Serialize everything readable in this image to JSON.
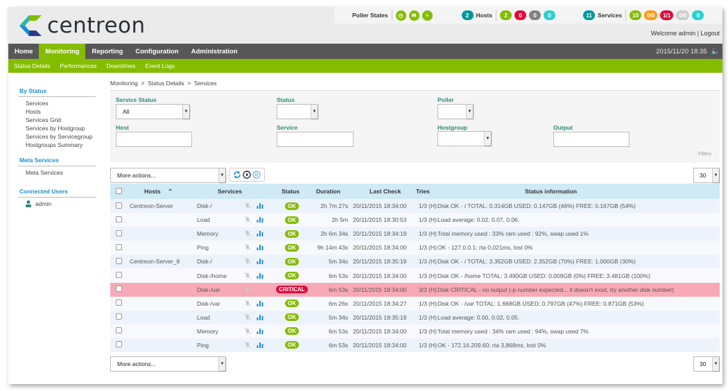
{
  "brand": {
    "name": "centreon"
  },
  "status_bar": {
    "poller_label": "Poller States",
    "hosts": {
      "total": "2",
      "label": "Hosts",
      "up": "2",
      "down": "0",
      "unreachable": "0",
      "pending": "0"
    },
    "services": {
      "total": "11",
      "label": "Services",
      "ok": "10",
      "warning": "0/0",
      "critical": "1/1",
      "unknown": "0/0",
      "pending": "0"
    },
    "colors": {
      "green": "#84bd00",
      "red": "#e00b3d",
      "grey": "#818285",
      "cyan": "#29d1d3",
      "teal": "#00989d",
      "orange": "#ff9a13",
      "lightgrey": "#cdcdcd"
    }
  },
  "welcome": {
    "text": "Welcome admin",
    "logout": "Logout"
  },
  "nav": {
    "tabs": [
      {
        "label": "Home",
        "active": false
      },
      {
        "label": "Monitoring",
        "active": true
      },
      {
        "label": "Reporting",
        "active": false
      },
      {
        "label": "Configuration",
        "active": false
      },
      {
        "label": "Administration",
        "active": false
      }
    ],
    "clock": "2015/11/20 18:35"
  },
  "subnav": [
    "Status Details",
    "Performances",
    "Downtimes",
    "Event Logs"
  ],
  "sidebar": {
    "groups": [
      {
        "title": "By Status",
        "items": [
          "Services",
          "Hosts",
          "Services Grid",
          "Services by Hostgroup",
          "Services by Servicegroup",
          "Hostgroups Summary"
        ]
      },
      {
        "title": "Meta Services",
        "items": [
          "Meta Services"
        ]
      },
      {
        "title": "Connected Users",
        "items": []
      }
    ],
    "user": "admin"
  },
  "breadcrumb": "Monitoring  >  Status Details  >  Services",
  "filters": {
    "service_status": {
      "label": "Service Status",
      "value": "All"
    },
    "status": {
      "label": "Status",
      "value": ""
    },
    "poller": {
      "label": "Poller",
      "value": ""
    },
    "host": {
      "label": "Host",
      "value": ""
    },
    "service": {
      "label": "Service",
      "value": ""
    },
    "hostgroup": {
      "label": "Hostgroup",
      "value": ""
    },
    "output": {
      "label": "Output",
      "value": ""
    },
    "tag": "Filters"
  },
  "actions": {
    "more_actions": "More actions...",
    "page_size": "30"
  },
  "table": {
    "headers": {
      "hosts": "Hosts",
      "services": "Services",
      "status": "Status",
      "duration": "Duration",
      "last_check": "Last Check",
      "tries": "Tries",
      "info": "Status information"
    },
    "rows": [
      {
        "host": "Centreon-Server",
        "service": "Disk-/",
        "status": "OK",
        "duration": "2h 7m 27s",
        "last_check": "20/11/2015 18:34:00",
        "tries": "1/3 (H)",
        "info": "Disk OK - / TOTAL: 0.314GB USED: 0.147GB (46%) FREE: 0.167GB (54%)"
      },
      {
        "host": "",
        "service": "Load",
        "status": "OK",
        "duration": "2h 5m",
        "last_check": "20/11/2015 18:30:53",
        "tries": "1/3 (H)",
        "info": "Load average: 0.02, 0.07, 0.06."
      },
      {
        "host": "",
        "service": "Memory",
        "status": "OK",
        "duration": "2h 6m 34s",
        "last_check": "20/11/2015 18:34:19",
        "tries": "1/3 (H)",
        "info": "Total memory used : 33% ram used : 92%, swap used 1%"
      },
      {
        "host": "",
        "service": "Ping",
        "status": "OK",
        "duration": "9h 14m 43s",
        "last_check": "20/11/2015 18:34:00",
        "tries": "1/3 (H)",
        "info": "OK - 127.0.0.1: rta 0,021ms, lost 0%"
      },
      {
        "host": "Centreon-Server_8",
        "service": "Disk-/",
        "status": "OK",
        "duration": "5m 34s",
        "last_check": "20/11/2015 18:35:19",
        "tries": "1/3 (H)",
        "info": "Disk OK - / TOTAL: 3.352GB USED: 2.352GB (70%) FREE: 1.000GB (30%)"
      },
      {
        "host": "",
        "service": "Disk-/home",
        "status": "OK",
        "duration": "6m 53s",
        "last_check": "20/11/2015 18:34:00",
        "tries": "1/3 (H)",
        "info": "Disk OK - /home TOTAL: 3.490GB USED: 0.009GB (0%) FREE: 3.481GB (100%)"
      },
      {
        "host": "",
        "service": "Disk-/usr",
        "status": "CRITICAL",
        "duration": "6m 53s",
        "last_check": "20/11/2015 18:34:00",
        "tries": "3/3 (H)",
        "info": "Disk CRITICAL - no output (-p number expected... it doesn't exist, try another disk number)"
      },
      {
        "host": "",
        "service": "Disk-/var",
        "status": "OK",
        "duration": "6m 26s",
        "last_check": "20/11/2015 18:34:27",
        "tries": "1/3 (H)",
        "info": "Disk OK - /var TOTAL: 1.668GB USED: 0.797GB (47%) FREE: 0.871GB (53%)"
      },
      {
        "host": "",
        "service": "Load",
        "status": "OK",
        "duration": "5m 34s",
        "last_check": "20/11/2015 18:35:19",
        "tries": "1/3 (H)",
        "info": "Load average: 0.00, 0.02, 0.05."
      },
      {
        "host": "",
        "service": "Memory",
        "status": "OK",
        "duration": "6m 53s",
        "last_check": "20/11/2015 18:34:00",
        "tries": "1/3 (H)",
        "info": "Total memory used : 34% ram used : 94%, swap used 7%"
      },
      {
        "host": "",
        "service": "Ping",
        "status": "OK",
        "duration": "6m 53s",
        "last_check": "20/11/2015 18:34:00",
        "tries": "1/3 (H)",
        "info": "OK - 172.16.209.60: rta 3,868ms, lost 0%"
      }
    ]
  }
}
